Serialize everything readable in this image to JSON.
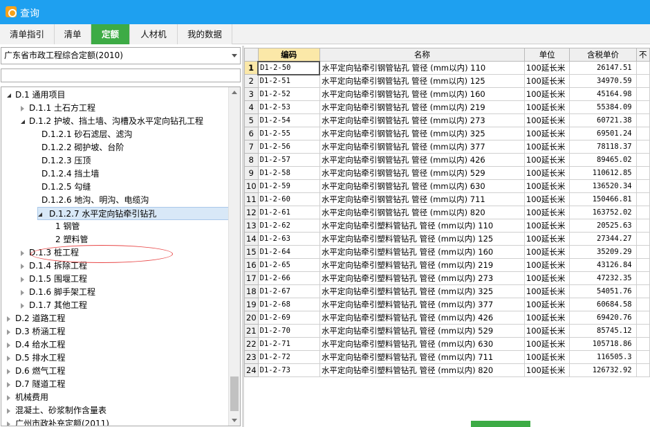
{
  "window": {
    "title": "查询"
  },
  "tabs": [
    {
      "label": "清单指引",
      "active": false
    },
    {
      "label": "清单",
      "active": false
    },
    {
      "label": "定额",
      "active": true
    },
    {
      "label": "人材机",
      "active": false
    },
    {
      "label": "我的数据",
      "active": false
    }
  ],
  "library_select": {
    "value": "广东省市政工程综合定额(2010)"
  },
  "tree": [
    {
      "label": "D.1 通用项目",
      "level": 0,
      "state": "expanded"
    },
    {
      "label": "D.1.1 土石方工程",
      "level": 1,
      "state": "collapsed"
    },
    {
      "label": "D.1.2 护坡、挡土墙、沟槽及水平定向钻孔工程",
      "level": 1,
      "state": "expanded"
    },
    {
      "label": "D.1.2.1 砂石滤层、滤沟",
      "level": 2,
      "state": "leaf"
    },
    {
      "label": "D.1.2.2 砌护坡、台阶",
      "level": 2,
      "state": "leaf"
    },
    {
      "label": "D.1.2.3 压顶",
      "level": 2,
      "state": "leaf"
    },
    {
      "label": "D.1.2.4 挡土墙",
      "level": 2,
      "state": "leaf"
    },
    {
      "label": "D.1.2.5 勾缝",
      "level": 2,
      "state": "leaf"
    },
    {
      "label": "D.1.2.6 地沟、明沟、电缆沟",
      "level": 2,
      "state": "leaf"
    },
    {
      "label": "D.1.2.7 水平定向钻牵引钻孔",
      "level": 2,
      "state": "expanded",
      "selected": true
    },
    {
      "label": "1 钢管",
      "level": 3,
      "state": "leaf"
    },
    {
      "label": "2 塑料管",
      "level": 3,
      "state": "leaf"
    },
    {
      "label": "D.1.3 桩工程",
      "level": 1,
      "state": "collapsed"
    },
    {
      "label": "D.1.4 拆除工程",
      "level": 1,
      "state": "collapsed"
    },
    {
      "label": "D.1.5 围堰工程",
      "level": 1,
      "state": "collapsed"
    },
    {
      "label": "D.1.6 脚手架工程",
      "level": 1,
      "state": "collapsed"
    },
    {
      "label": "D.1.7 其他工程",
      "level": 1,
      "state": "collapsed"
    },
    {
      "label": "D.2 道路工程",
      "level": 0,
      "state": "collapsed"
    },
    {
      "label": "D.3 桥涵工程",
      "level": 0,
      "state": "collapsed"
    },
    {
      "label": "D.4 给水工程",
      "level": 0,
      "state": "collapsed"
    },
    {
      "label": "D.5 排水工程",
      "level": 0,
      "state": "collapsed"
    },
    {
      "label": "D.6 燃气工程",
      "level": 0,
      "state": "collapsed"
    },
    {
      "label": "D.7 隧道工程",
      "level": 0,
      "state": "collapsed"
    },
    {
      "label": "机械费用",
      "level": 0,
      "state": "collapsed"
    },
    {
      "label": "混凝土、砂浆制作含量表",
      "level": 0,
      "state": "collapsed"
    },
    {
      "label": "广州市政补充定额(2011)",
      "level": 0,
      "state": "collapsed"
    }
  ],
  "table": {
    "columns": [
      "编码",
      "名称",
      "单位",
      "含税单价",
      "不"
    ],
    "rows": [
      {
        "n": "1",
        "code": "D1-2-50",
        "name": "水平定向钻牵引钢管钻孔 管径 (mm以内) 110",
        "unit": "100延长米",
        "price": "26147.51"
      },
      {
        "n": "2",
        "code": "D1-2-51",
        "name": "水平定向钻牵引钢管钻孔 管径 (mm以内) 125",
        "unit": "100延长米",
        "price": "34970.59"
      },
      {
        "n": "3",
        "code": "D1-2-52",
        "name": "水平定向钻牵引钢管钻孔 管径 (mm以内) 160",
        "unit": "100延长米",
        "price": "45164.98"
      },
      {
        "n": "4",
        "code": "D1-2-53",
        "name": "水平定向钻牵引钢管钻孔 管径 (mm以内) 219",
        "unit": "100延长米",
        "price": "55384.09"
      },
      {
        "n": "5",
        "code": "D1-2-54",
        "name": "水平定向钻牵引钢管钻孔 管径 (mm以内) 273",
        "unit": "100延长米",
        "price": "60721.38"
      },
      {
        "n": "6",
        "code": "D1-2-55",
        "name": "水平定向钻牵引钢管钻孔 管径 (mm以内) 325",
        "unit": "100延长米",
        "price": "69501.24"
      },
      {
        "n": "7",
        "code": "D1-2-56",
        "name": "水平定向钻牵引钢管钻孔 管径 (mm以内) 377",
        "unit": "100延长米",
        "price": "78118.37"
      },
      {
        "n": "8",
        "code": "D1-2-57",
        "name": "水平定向钻牵引钢管钻孔 管径 (mm以内) 426",
        "unit": "100延长米",
        "price": "89465.02"
      },
      {
        "n": "9",
        "code": "D1-2-58",
        "name": "水平定向钻牵引钢管钻孔 管径 (mm以内) 529",
        "unit": "100延长米",
        "price": "110612.85"
      },
      {
        "n": "10",
        "code": "D1-2-59",
        "name": "水平定向钻牵引钢管钻孔 管径 (mm以内) 630",
        "unit": "100延长米",
        "price": "136520.34"
      },
      {
        "n": "11",
        "code": "D1-2-60",
        "name": "水平定向钻牵引钢管钻孔 管径 (mm以内) 711",
        "unit": "100延长米",
        "price": "150466.81"
      },
      {
        "n": "12",
        "code": "D1-2-61",
        "name": "水平定向钻牵引钢管钻孔 管径 (mm以内) 820",
        "unit": "100延长米",
        "price": "163752.02"
      },
      {
        "n": "13",
        "code": "D1-2-62",
        "name": "水平定向钻牵引塑料管钻孔 管径 (mm以内) 110",
        "unit": "100延长米",
        "price": "20525.63"
      },
      {
        "n": "14",
        "code": "D1-2-63",
        "name": "水平定向钻牵引塑料管钻孔 管径 (mm以内) 125",
        "unit": "100延长米",
        "price": "27344.27"
      },
      {
        "n": "15",
        "code": "D1-2-64",
        "name": "水平定向钻牵引塑料管钻孔 管径 (mm以内) 160",
        "unit": "100延长米",
        "price": "35209.29"
      },
      {
        "n": "16",
        "code": "D1-2-65",
        "name": "水平定向钻牵引塑料管钻孔 管径 (mm以内) 219",
        "unit": "100延长米",
        "price": "43126.84"
      },
      {
        "n": "17",
        "code": "D1-2-66",
        "name": "水平定向钻牵引塑料管钻孔 管径 (mm以内) 273",
        "unit": "100延长米",
        "price": "47232.35"
      },
      {
        "n": "18",
        "code": "D1-2-67",
        "name": "水平定向钻牵引塑料管钻孔 管径 (mm以内) 325",
        "unit": "100延长米",
        "price": "54051.76"
      },
      {
        "n": "19",
        "code": "D1-2-68",
        "name": "水平定向钻牵引塑料管钻孔 管径 (mm以内) 377",
        "unit": "100延长米",
        "price": "60684.58"
      },
      {
        "n": "20",
        "code": "D1-2-69",
        "name": "水平定向钻牵引塑料管钻孔 管径 (mm以内) 426",
        "unit": "100延长米",
        "price": "69420.76"
      },
      {
        "n": "21",
        "code": "D1-2-70",
        "name": "水平定向钻牵引塑料管钻孔 管径 (mm以内) 529",
        "unit": "100延长米",
        "price": "85745.12"
      },
      {
        "n": "22",
        "code": "D1-2-71",
        "name": "水平定向钻牵引塑料管钻孔 管径 (mm以内) 630",
        "unit": "100延长米",
        "price": "105718.86"
      },
      {
        "n": "23",
        "code": "D1-2-72",
        "name": "水平定向钻牵引塑料管钻孔 管径 (mm以内) 711",
        "unit": "100延长米",
        "price": "116505.3"
      },
      {
        "n": "24",
        "code": "D1-2-73",
        "name": "水平定向钻牵引塑料管钻孔 管径 (mm以内) 820",
        "unit": "100延长米",
        "price": "126732.92"
      }
    ]
  },
  "colors": {
    "titlebar": "#1ea0f0",
    "active_tab": "#3dab45",
    "header_highlight": "#fbe8a8",
    "annotation": "#e84545"
  }
}
